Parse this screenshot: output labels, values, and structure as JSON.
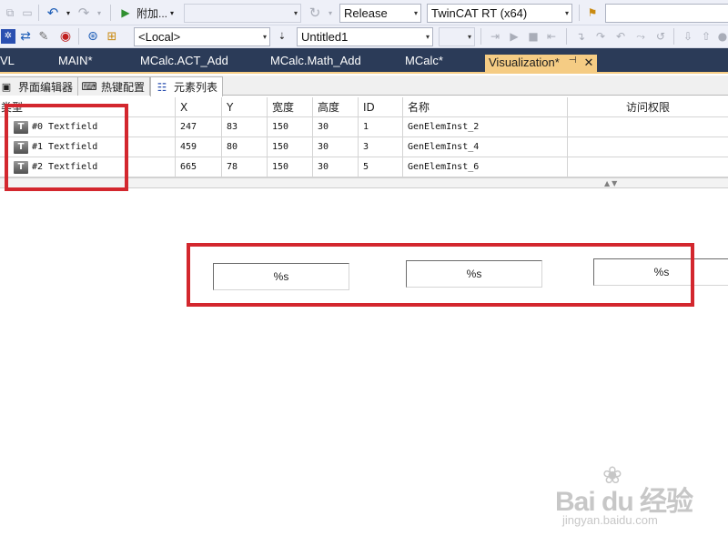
{
  "toolbar1": {
    "undo_icon": "undo-icon",
    "redo_icon": "redo-icon",
    "attach_label": "附加...",
    "configuration": "Release",
    "platform": "TwinCAT RT (x64)",
    "search_value": ""
  },
  "toolbar2": {
    "target": "<Local>",
    "project": "Untitled1",
    "extra_value": ""
  },
  "doc_tabs": [
    "VL",
    "MAIN*",
    "MCalc.ACT_Add",
    "MCalc.Math_Add",
    "MCalc*",
    "Visualization*"
  ],
  "doc_tab_active_index": 5,
  "doc_tab_pin": "⊣",
  "doc_tab_close": "✕",
  "sub_tabs": [
    "界面编辑器",
    "热键配置",
    "元素列表"
  ],
  "sub_tab_active_index": 2,
  "grid": {
    "headers": {
      "type": "类型",
      "x": "X",
      "y": "Y",
      "width": "宽度",
      "height": "高度",
      "id": "ID",
      "name": "名称",
      "access": "访问权限"
    },
    "rows": [
      {
        "type": "#0 Textfield",
        "x": "247",
        "y": "83",
        "width": "150",
        "height": "30",
        "id": "1",
        "name": "GenElemInst_2",
        "access": ""
      },
      {
        "type": "#1 Textfield",
        "x": "459",
        "y": "80",
        "width": "150",
        "height": "30",
        "id": "3",
        "name": "GenElemInst_4",
        "access": ""
      },
      {
        "type": "#2 Textfield",
        "x": "665",
        "y": "78",
        "width": "150",
        "height": "30",
        "id": "5",
        "name": "GenElemInst_6",
        "access": ""
      }
    ],
    "row_icon_glyph": "T"
  },
  "canvas": {
    "textfields": [
      "%s",
      "%s",
      "%s"
    ]
  },
  "watermark": {
    "brand": "Bai du 经验",
    "url": "jingyan.baidu.com"
  },
  "colors": {
    "highlight": "#d3272e",
    "doc_tab_bar": "#2b3b58",
    "doc_tab_active": "#f5cc84",
    "toolbar": "#eef0f8"
  }
}
